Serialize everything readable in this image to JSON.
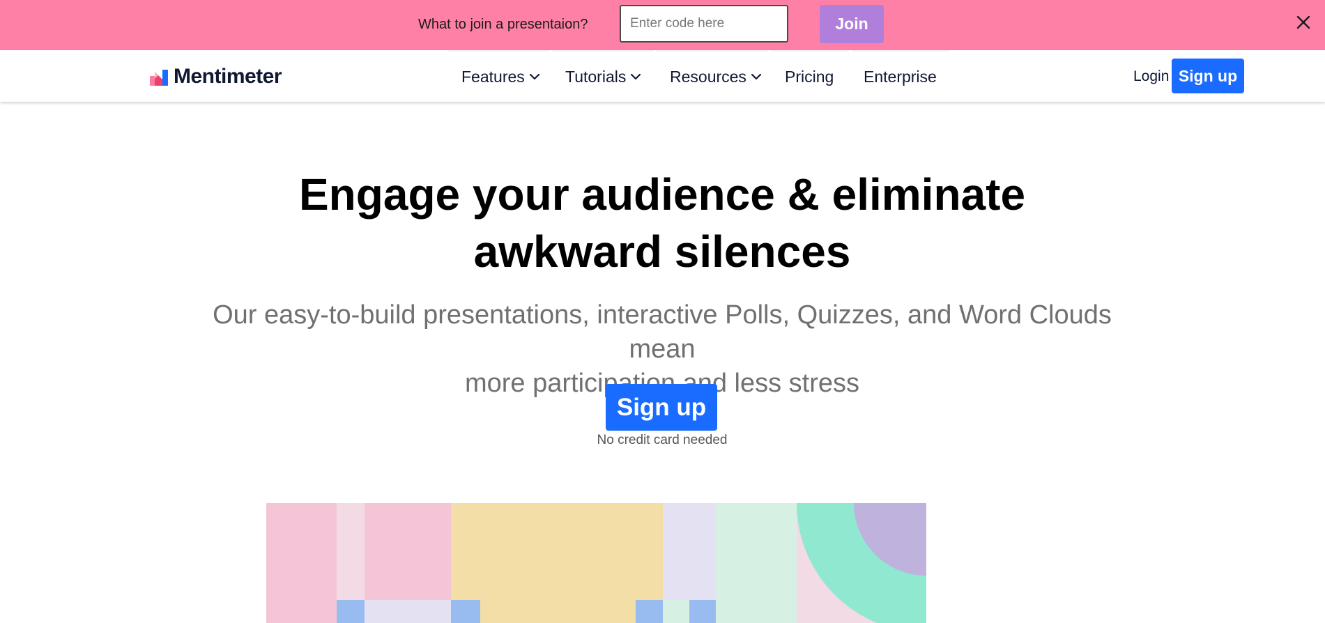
{
  "banner": {
    "prompt": "What to join a presentaion?",
    "code_placeholder": "Enter code here",
    "join_label": "Join",
    "background": "#ff80a6",
    "join_color": "#b07fdb",
    "close_icon": "close-icon"
  },
  "nav": {
    "logo_text": "Mentimeter",
    "items": [
      {
        "label": "Features",
        "has_dropdown": true
      },
      {
        "label": "Tutorials",
        "has_dropdown": true
      },
      {
        "label": "Resources",
        "has_dropdown": true
      },
      {
        "label": "Pricing",
        "has_dropdown": false
      },
      {
        "label": "Enterprise",
        "has_dropdown": false
      }
    ],
    "login_label": "Login",
    "signup_label": "Sign up"
  },
  "hero": {
    "title_line1": "Engage your audience & eliminate",
    "title_line2": "awkward silences",
    "subtitle_line1": "Our easy-to-build presentations, interactive Polls, Quizzes, and Word Clouds mean",
    "subtitle_line2": "more participation and less stress",
    "signup_label": "Sign up",
    "note": "No credit card needed"
  },
  "theme": {
    "primary_blue": "#196cff",
    "text_dark": "#101834",
    "subtitle_gray": "#707070"
  }
}
